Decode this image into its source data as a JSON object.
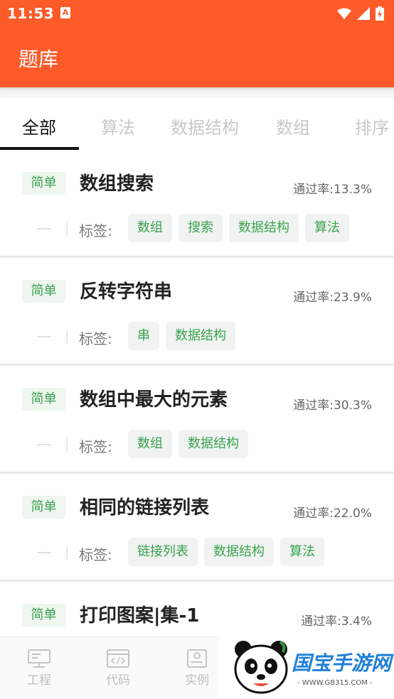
{
  "status_bar": {
    "time": "11:53",
    "notification_icon": "A",
    "icons": [
      "wifi-icon",
      "signal-icon",
      "battery-charging-icon"
    ]
  },
  "header": {
    "title": "题库"
  },
  "tabs": [
    {
      "label": "全部",
      "active": true
    },
    {
      "label": "算法",
      "active": false
    },
    {
      "label": "数据结构",
      "active": false
    },
    {
      "label": "数组",
      "active": false
    },
    {
      "label": "排序",
      "active": false
    }
  ],
  "tag_label": "标签:",
  "questions": [
    {
      "difficulty": "简单",
      "title": "数组搜索",
      "pass_rate": "通过率:13.3%",
      "tags": [
        "数组",
        "搜索",
        "数据结构",
        "算法"
      ]
    },
    {
      "difficulty": "简单",
      "title": "反转字符串",
      "pass_rate": "通过率:23.9%",
      "tags": [
        "串",
        "数据结构"
      ]
    },
    {
      "difficulty": "简单",
      "title": "数组中最大的元素",
      "pass_rate": "通过率:30.3%",
      "tags": [
        "数组",
        "数据结构"
      ]
    },
    {
      "difficulty": "简单",
      "title": "相同的链接列表",
      "pass_rate": "通过率:22.0%",
      "tags": [
        "链接列表",
        "数据结构",
        "算法"
      ]
    },
    {
      "difficulty": "简单",
      "title": "打印图案|集-1",
      "pass_rate": "通过率:3.4%",
      "tags": []
    }
  ],
  "bottom_nav": [
    {
      "label": "工程",
      "icon": "project-icon"
    },
    {
      "label": "代码",
      "icon": "code-icon"
    },
    {
      "label": "实例",
      "icon": "example-icon"
    }
  ],
  "watermark": {
    "text": "国宝手游网",
    "url": "- WWW.GB315.COM -",
    "icon": "panda-logo"
  },
  "colors": {
    "accent": "#fd5b2a",
    "tag_green": "#3aa24e",
    "tag_bg": "#f0f3f1",
    "badge_bg": "#eef6ef"
  }
}
